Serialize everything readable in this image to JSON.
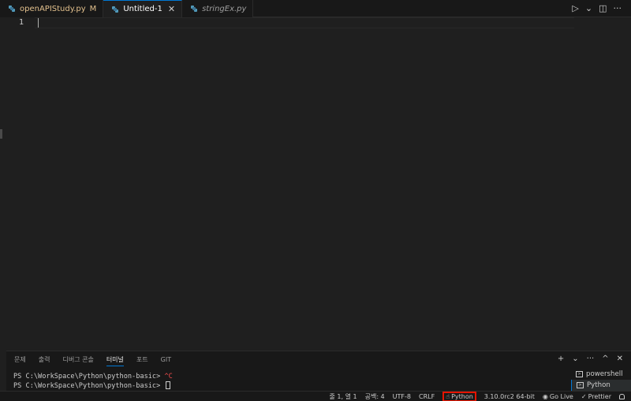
{
  "tabs": [
    {
      "label": "openAPIStudy.py",
      "flag": "M",
      "state": "modified"
    },
    {
      "label": "Untitled-1",
      "state": "active",
      "close": "✕"
    },
    {
      "label": "stringEx.py",
      "state": "preview"
    }
  ],
  "tab_actions": {
    "run_icon": "▷",
    "run_menu": "⌄",
    "split_icon": "◫",
    "more": "···"
  },
  "editor": {
    "line_number": "1"
  },
  "panel": {
    "tabs": [
      "문제",
      "출력",
      "디버그 콘솔",
      "터미널",
      "포트",
      "GIT"
    ],
    "actions": {
      "add": "+",
      "add_menu": "⌄",
      "more": "···",
      "maximize": "^",
      "close": "✕"
    },
    "terminal": {
      "line1_prompt": "PS C:\\WorkSpace\\Python\\python-basic> ",
      "line1_ctrl": "^C",
      "line2_prompt": "PS C:\\WorkSpace\\Python\\python-basic> "
    },
    "terminal_list": [
      "powershell",
      "Python"
    ]
  },
  "statusbar": {
    "position": "줄 1, 열 1",
    "spaces": "공백: 4",
    "encoding": "UTF-8",
    "eol": "CRLF",
    "language": "Python",
    "interpreter": "3.10.0rc2 64-bit",
    "go_live": "Go Live",
    "prettier": "Prettier"
  },
  "colors": {
    "accent": "#0078d4",
    "highlight_box": "#e51400",
    "modified": "#e2c08d",
    "python_icon": "#519aba"
  }
}
